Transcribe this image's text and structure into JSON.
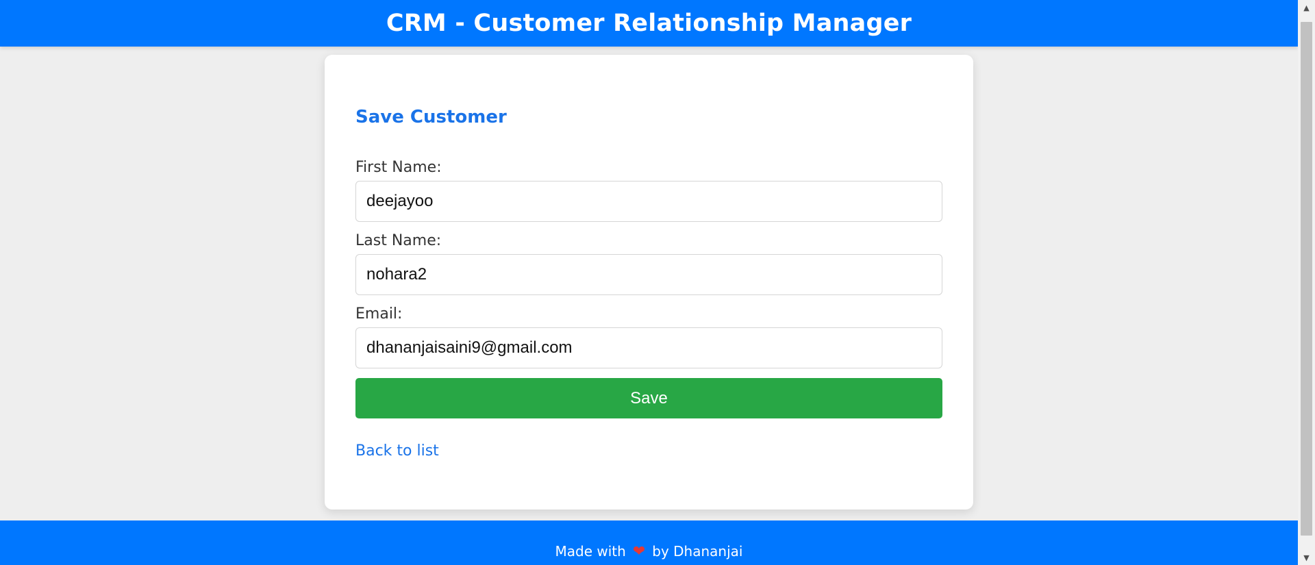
{
  "header": {
    "title": "CRM - Customer Relationship Manager"
  },
  "form": {
    "title": "Save Customer",
    "first_name": {
      "label": "First Name:",
      "value": "deejayoo"
    },
    "last_name": {
      "label": "Last Name:",
      "value": "nohara2"
    },
    "email": {
      "label": "Email:",
      "value": "dhananjaisaini9@gmail.com"
    },
    "save_label": "Save",
    "back_link_label": "Back to list"
  },
  "footer": {
    "prefix": "Made with",
    "heart_icon": "heart-icon",
    "heart_glyph": "❤",
    "suffix": "by Dhananjai"
  },
  "colors": {
    "brand_blue": "#0077ff",
    "link_blue": "#1a73e8",
    "save_green": "#28a745",
    "page_background": "#eeeeee"
  }
}
